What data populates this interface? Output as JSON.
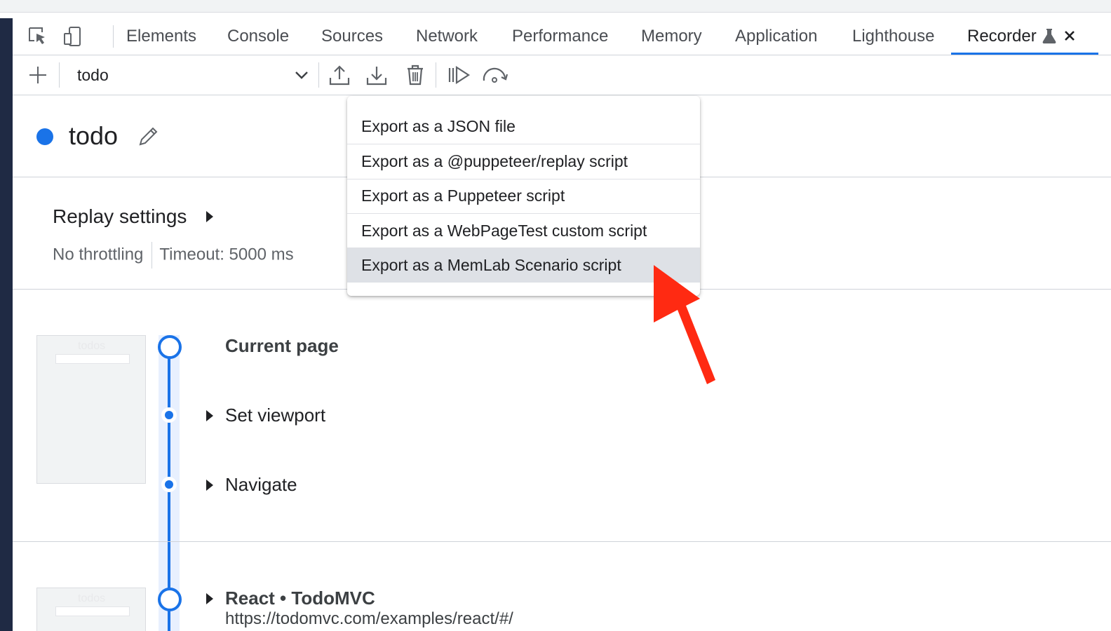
{
  "tabs": [
    {
      "label": "Elements"
    },
    {
      "label": "Console"
    },
    {
      "label": "Sources"
    },
    {
      "label": "Network"
    },
    {
      "label": "Performance"
    },
    {
      "label": "Memory"
    },
    {
      "label": "Application"
    },
    {
      "label": "Lighthouse"
    },
    {
      "label": "Recorder"
    }
  ],
  "active_tab": "Recorder",
  "toolbar": {
    "recording_select": "todo"
  },
  "recording": {
    "title": "todo"
  },
  "replay": {
    "title": "Replay settings",
    "throttling": "No throttling",
    "timeout": "Timeout: 5000 ms"
  },
  "export_menu": {
    "items": [
      {
        "label": "Export as a JSON file"
      },
      {
        "label": "Export as a @puppeteer/replay script"
      },
      {
        "label": "Export as a Puppeteer script"
      },
      {
        "label": "Export as a WebPageTest custom script"
      },
      {
        "label": "Export as a MemLab Scenario script"
      }
    ],
    "highlighted": "Export as a MemLab Scenario script"
  },
  "steps": {
    "section1": {
      "title": "Current page",
      "items": [
        {
          "label": "Set viewport"
        },
        {
          "label": "Navigate"
        }
      ]
    },
    "section2": {
      "title": "React • TodoMVC",
      "url": "https://todomvc.com/examples/react/#/"
    }
  },
  "thumbnail": {
    "word": "todos"
  },
  "colors": {
    "accent": "#1a73e8",
    "annotation_arrow": "#ff2a12",
    "menu_highlight": "#dee1e6"
  },
  "icons": [
    "inspect-element-icon",
    "device-toolbar-icon",
    "experiment-flask-icon",
    "close-icon",
    "add-icon",
    "chevron-down-icon",
    "export-icon",
    "import-icon",
    "delete-icon",
    "replay-icon",
    "replay-slow-icon",
    "edit-icon",
    "expand-triangle-icon"
  ]
}
